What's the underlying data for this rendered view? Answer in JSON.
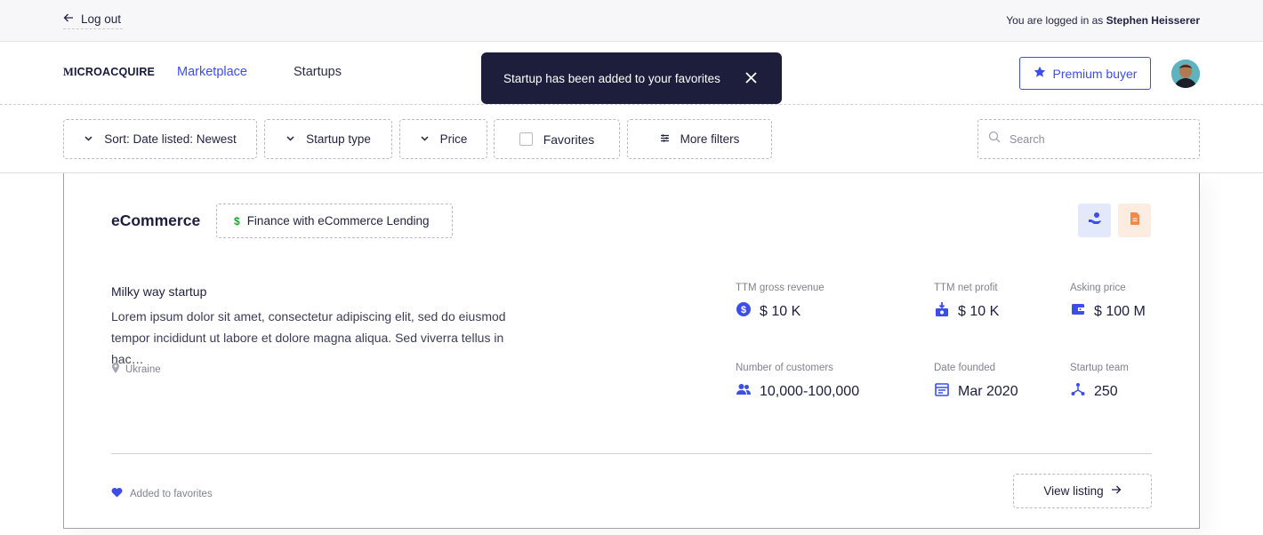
{
  "topbar": {
    "logout_label": "Log out",
    "logged_prefix": "You are logged in as",
    "username": "Stephen Heisserer"
  },
  "nav": {
    "logo": "ICROACQUIRE",
    "logo_initial": "M",
    "links": [
      "Marketplace",
      "Startups"
    ],
    "premium_label": "Premium buyer"
  },
  "toast": {
    "message": "Startup has been added to your favorites"
  },
  "filters": {
    "sort_label": "Sort: Date listed: Newest",
    "type_label": "Startup type",
    "price_label": "Price",
    "favorites_label": "Favorites",
    "favorites_checked": false,
    "more_label": "More filters",
    "search_placeholder": "Search"
  },
  "listing": {
    "category": "eCommerce",
    "tag_label": "Finance with eCommerce Lending",
    "tag_icon": "$",
    "name": "Milky way startup",
    "description": "Lorem ipsum dolor sit amet, consectetur adipiscing elit, sed do eiusmod tempor incididunt ut labore et dolore magna aliqua. Sed viverra tellus in hac…",
    "location": "Ukraine",
    "stats": {
      "revenue": {
        "label": "TTM gross revenue",
        "value": "$ 10 K"
      },
      "profit": {
        "label": "TTM net profit",
        "value": "$ 10 K"
      },
      "asking": {
        "label": "Asking price",
        "value": "$ 100 M"
      },
      "customers": {
        "label": "Number of customers",
        "value": "10,000-100,000"
      },
      "founded": {
        "label": "Date founded",
        "value": "Mar 2020"
      },
      "team": {
        "label": "Startup team",
        "value": "250"
      }
    },
    "favorite_status": "Added to favorites",
    "view_label": "View listing"
  },
  "colors": {
    "accent": "#3d4ee8",
    "toast_bg": "#1c1e3c",
    "orange": "#f08a4b",
    "green": "#2b9a3a"
  }
}
